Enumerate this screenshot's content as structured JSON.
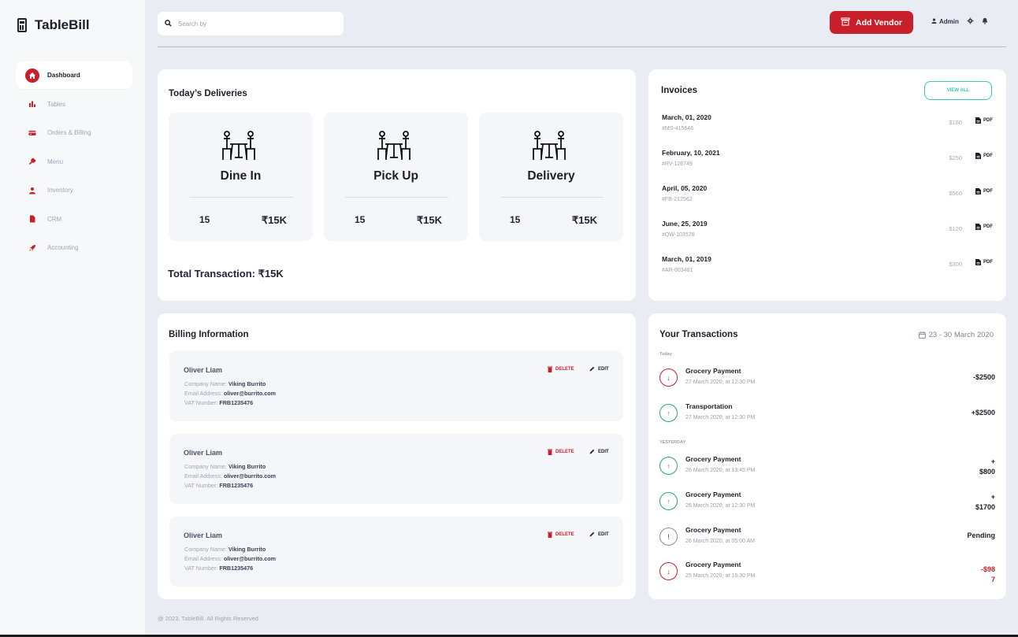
{
  "app": {
    "name": "TableBill"
  },
  "sidebar": {
    "items": [
      {
        "label": "Dashboard",
        "icon": "home-icon",
        "active": true
      },
      {
        "label": "Tables",
        "icon": "bar-chart-icon"
      },
      {
        "label": "Orders & Billing",
        "icon": "credit-card-icon"
      },
      {
        "label": "Menu",
        "icon": "wrench-icon"
      },
      {
        "label": "Inventory",
        "icon": "user-icon"
      },
      {
        "label": "CRM",
        "icon": "file-icon"
      },
      {
        "label": "Accounting",
        "icon": "rocket-icon"
      }
    ]
  },
  "topbar": {
    "search_placeholder": "Search by",
    "add_vendor_label": "Add Vendor",
    "user_label": "Admin"
  },
  "deliveries": {
    "title": "Today’s Deliveries",
    "boxes": [
      {
        "name": "Dine In",
        "count": "15",
        "amount": "₹15K"
      },
      {
        "name": "Pick Up",
        "count": "15",
        "amount": "₹15K"
      },
      {
        "name": "Delivery",
        "count": "15",
        "amount": "₹15K"
      }
    ],
    "total_label": "Total Transaction: ₹15K"
  },
  "invoices": {
    "title": "Invoices",
    "view_all_label": "VIEW ALL",
    "pdf_label": "PDF",
    "rows": [
      {
        "date": "March, 01, 2020",
        "id": "#MS-415646",
        "amount": "$180"
      },
      {
        "date": "February, 10, 2021",
        "id": "#RV-126749",
        "amount": "$250"
      },
      {
        "date": "April, 05, 2020",
        "id": "#FB-212562",
        "amount": "$560"
      },
      {
        "date": "June, 25, 2019",
        "id": "#QW-103578",
        "amount": "$120"
      },
      {
        "date": "March, 01, 2019",
        "id": "#AR-803481",
        "amount": "$300"
      }
    ]
  },
  "billing": {
    "title": "Billing Information",
    "company_label": "Company Name:",
    "email_label": "Email Address:",
    "vat_label": "VAT Number:",
    "delete_label": "DELETE",
    "edit_label": "EDIT",
    "entries": [
      {
        "name": "Oliver Liam",
        "company": "Viking Burrito",
        "email": "oliver@burrito.com",
        "vat": "FRB1235476"
      },
      {
        "name": "Oliver Liam",
        "company": "Viking Burrito",
        "email": "oliver@burrito.com",
        "vat": "FRB1235476"
      },
      {
        "name": "Oliver Liam",
        "company": "Viking Burrito",
        "email": "oliver@burrito.com",
        "vat": "FRB1235476"
      }
    ]
  },
  "transactions": {
    "title": "Your Transactions",
    "date_range": "23 - 30 March 2020",
    "today_label": "Today",
    "yesterday_label": "YESTERDAY",
    "rows": [
      {
        "name": "Grocery Payment",
        "date": "27 March 2020, at 12:30 PM",
        "amount": "-$2500",
        "icon": "↓",
        "tone": "red",
        "amount_color": "#1c1f2a"
      },
      {
        "name": "Transportation",
        "date": "27 March 2020, at 12:30 PM",
        "amount": "+$2500",
        "icon": "↑",
        "tone": "green",
        "amount_color": "#1c1f2a"
      },
      {
        "name": "Grocery Payment",
        "date": "26 March 2020, at 13:45 PM",
        "amount": "+\n$800",
        "icon": "↑",
        "tone": "green",
        "amount_color": "#1c1f2a"
      },
      {
        "name": "Grocery Payment",
        "date": "26 March 2020, at 12:30 PM",
        "amount": "+\n$1700",
        "icon": "↑",
        "tone": "green",
        "amount_color": "#1c1f2a"
      },
      {
        "name": "Grocery Payment",
        "date": "26 March 2020, at 05:00 AM",
        "amount": "Pending",
        "icon": "!",
        "tone": "grey",
        "amount_color": "#1c1f2a"
      },
      {
        "name": "Grocery Payment",
        "date": "25 March 2020, at 16:30 PM",
        "amount": "-$98\n7",
        "icon": "↓",
        "tone": "red",
        "amount_color": "#c8202a"
      }
    ]
  },
  "footer": {
    "text": "@ 2023, TableBill. All Rights Reserved"
  },
  "colors": {
    "brand_red": "#c8202a",
    "accent_teal": "#3ec5b4",
    "positive_green": "#27a86b"
  }
}
